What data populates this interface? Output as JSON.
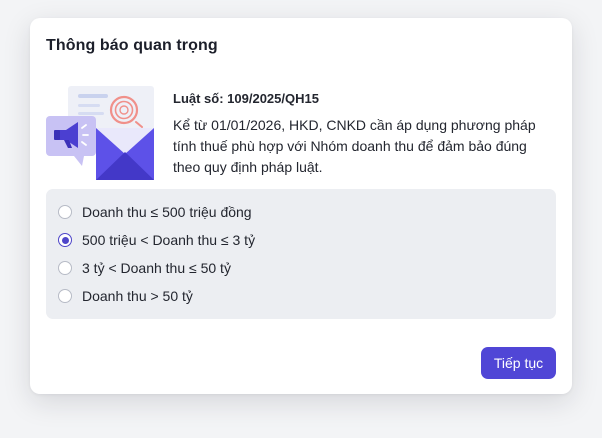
{
  "dialog": {
    "title": "Thông báo quan trọng",
    "law_number": "Luật số: 109/2025/QH15",
    "body": "Kể từ 01/01/2026, HKD, CNKD cần áp dụng phương pháp tính thuế phù hợp với Nhóm doanh thu để đảm bảo đúng theo quy định pháp luật.",
    "illustration_icon": "megaphone-envelope-illustration",
    "options": [
      {
        "label": "Doanh thu ≤ 500 triệu đồng",
        "selected": false
      },
      {
        "label": "500 triệu < Doanh thu ≤ 3 tỷ",
        "selected": true
      },
      {
        "label": "3 tỷ < Doanh thu ≤ 50 tỷ",
        "selected": false
      },
      {
        "label": "Doanh thu > 50 tỷ",
        "selected": false
      }
    ],
    "continue_label": "Tiếp tục"
  },
  "colors": {
    "accent": "#5046d6",
    "panel_bg": "#eceef2",
    "text": "#23262f"
  }
}
